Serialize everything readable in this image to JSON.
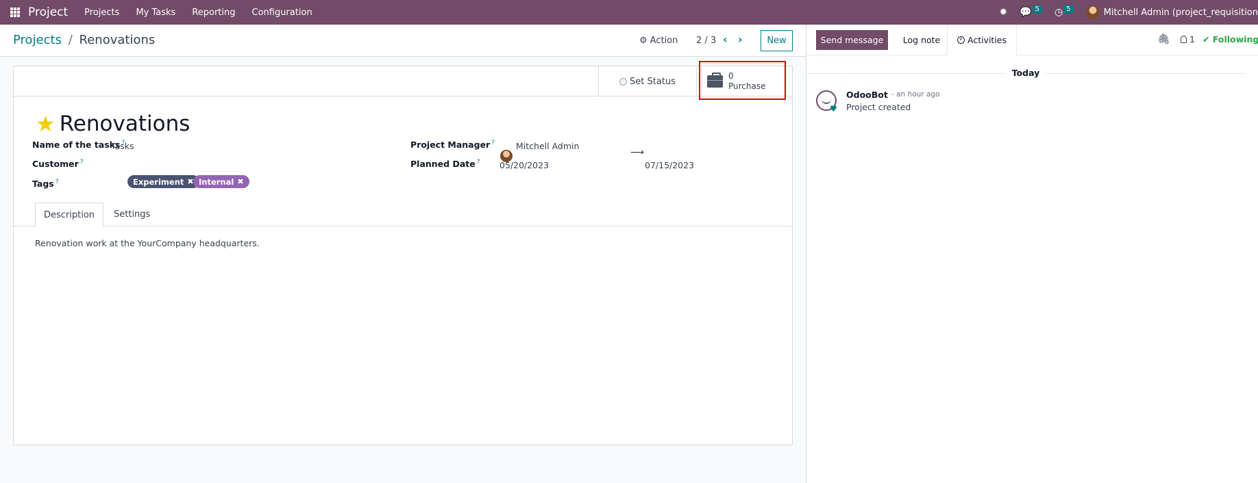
{
  "navbar": {
    "brand": "Project",
    "menu": [
      "Projects",
      "My Tasks",
      "Reporting",
      "Configuration"
    ],
    "messages_count": "5",
    "activities_count": "5",
    "user": "Mitchell Admin (project_requisition"
  },
  "control_panel": {
    "breadcrumb_parent": "Projects",
    "breadcrumb_sep": "/",
    "breadcrumb_current": "Renovations",
    "action_label": "Action",
    "pager": "2 / 3",
    "new_label": "New"
  },
  "form": {
    "set_status_label": "Set Status",
    "purchase_count": "0",
    "purchase_label": "Purchase",
    "title": "Renovations",
    "fields": {
      "tasks_label": "Name of the tasks",
      "tasks_value": "Tasks",
      "customer_label": "Customer",
      "tags_label": "Tags",
      "manager_label": "Project Manager",
      "manager_value": "Mitchell Admin",
      "planned_label": "Planned Date",
      "planned_start": "05/20/2023",
      "planned_end": "07/15/2023",
      "help_mark": "?"
    },
    "tags": [
      {
        "label": "Experiment",
        "color": "#4a5472"
      },
      {
        "label": "Internal",
        "color": "#9464b5"
      }
    ],
    "tabs": [
      "Description",
      "Settings"
    ],
    "active_tab": "Description",
    "description": "Renovation work at the YourCompany headquarters."
  },
  "chatter": {
    "send_message": "Send message",
    "log_note": "Log note",
    "activities": "Activities",
    "followers_count": "1",
    "following": "Following",
    "day": "Today",
    "messages": [
      {
        "author": "OdooBot",
        "time": "- an hour ago",
        "body": "Project created"
      }
    ]
  },
  "colors": {
    "brand": "#714b67",
    "accent": "#017e84",
    "highlight": "#e00000"
  }
}
